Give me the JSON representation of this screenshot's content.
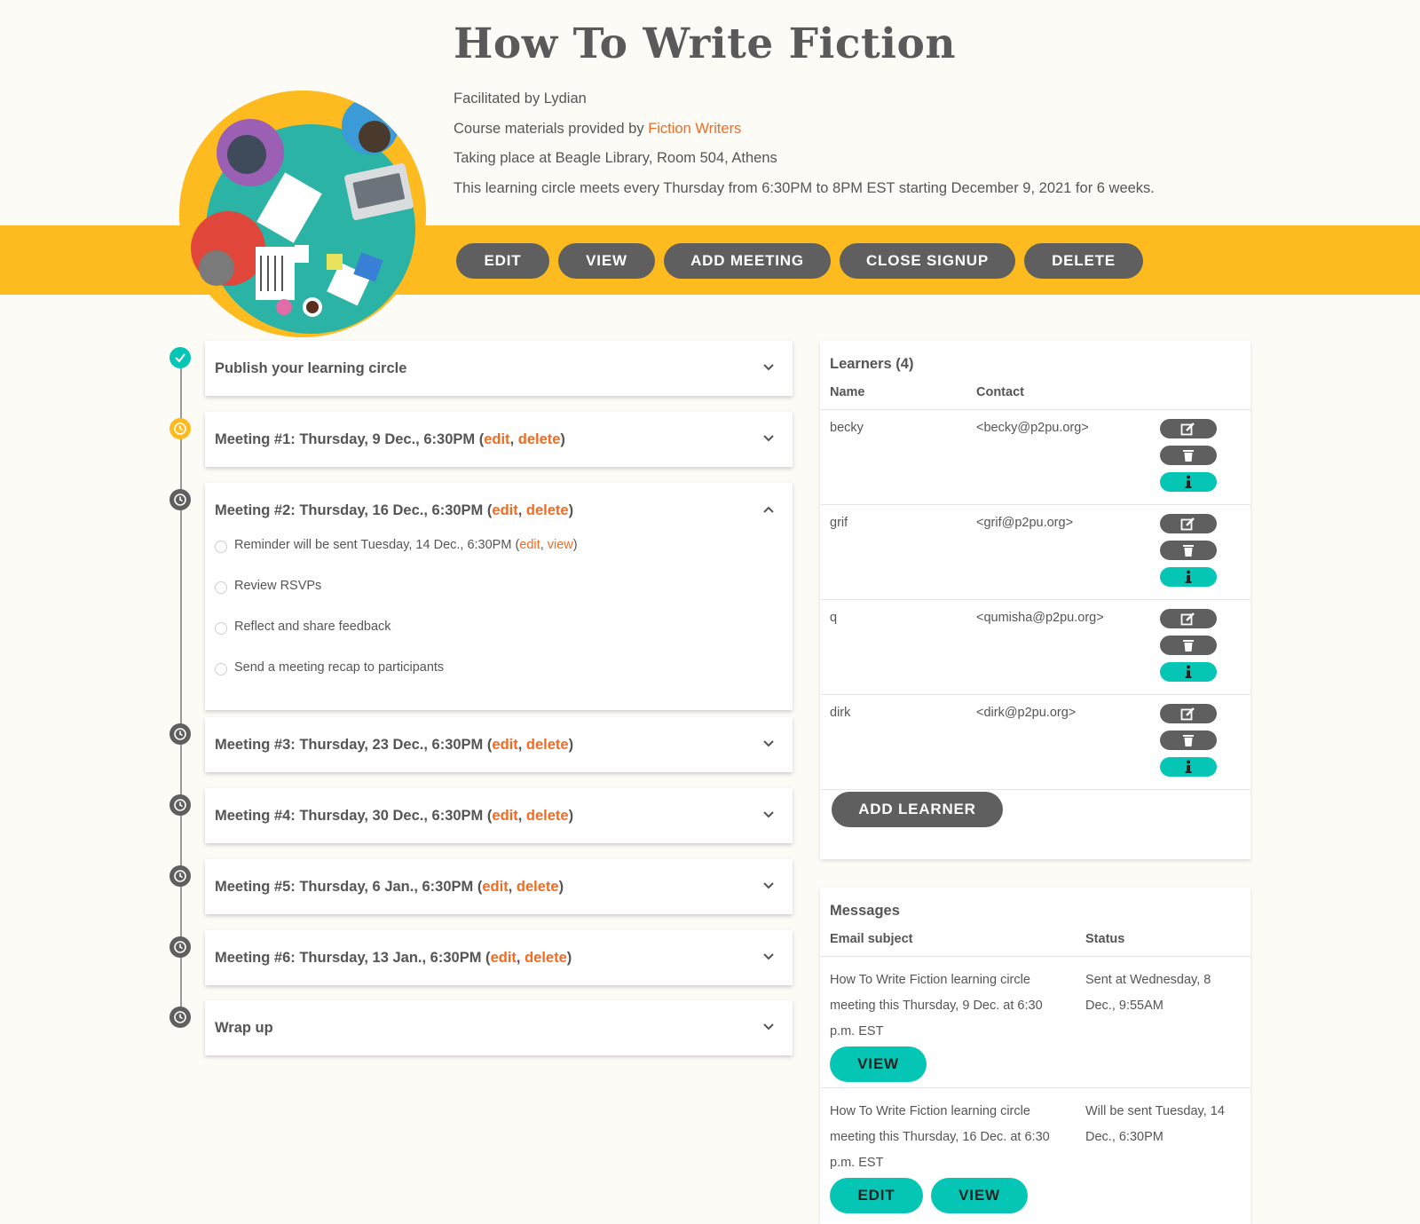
{
  "course": {
    "title": "How To Write Fiction",
    "facilitated_by": "Facilitated by Lydian",
    "materials_prefix": "Course materials provided by ",
    "materials_link": "Fiction Writers",
    "location": "Taking place at Beagle Library, Room 504, Athens",
    "schedule": "This learning circle meets every Thursday from 6:30PM to 8PM EST starting December 9, 2021 for 6 weeks."
  },
  "actions": {
    "edit": "EDIT",
    "view": "VIEW",
    "add_meeting": "ADD MEETING",
    "close_signup": "CLOSE SIGNUP",
    "delete": "DELETE"
  },
  "timeline": {
    "publish": "Publish your learning circle",
    "wrap_up": "Wrap up",
    "edit_link": "edit",
    "delete_link": "delete",
    "view_link": "view",
    "meetings": [
      {
        "label": "Meeting #1: Thursday, 9 Dec., 6:30PM",
        "status": "pending"
      },
      {
        "label": "Meeting #2: Thursday, 16 Dec., 6:30PM",
        "status": "future"
      },
      {
        "label": "Meeting #3: Thursday, 23 Dec., 6:30PM",
        "status": "future"
      },
      {
        "label": "Meeting #4: Thursday, 30 Dec., 6:30PM",
        "status": "future"
      },
      {
        "label": "Meeting #5: Thursday, 6 Jan., 6:30PM",
        "status": "future"
      },
      {
        "label": "Meeting #6: Thursday, 13 Jan., 6:30PM",
        "status": "future"
      }
    ],
    "meeting2_tasks": {
      "reminder": "Reminder will be sent Tuesday, 14 Dec., 6:30PM",
      "rsvps": "Review RSVPs",
      "reflect": "Reflect and share feedback",
      "recap": "Send a meeting recap to participants"
    }
  },
  "learners": {
    "title": "Learners (4)",
    "col_name": "Name",
    "col_contact": "Contact",
    "rows": [
      {
        "name": "becky",
        "contact": "<becky@p2pu.org>"
      },
      {
        "name": "grif",
        "contact": "<grif@p2pu.org>"
      },
      {
        "name": "q",
        "contact": "<qumisha@p2pu.org>"
      },
      {
        "name": "dirk",
        "contact": "<dirk@p2pu.org>"
      }
    ],
    "add_button": "ADD LEARNER"
  },
  "messages": {
    "title": "Messages",
    "col_subject": "Email subject",
    "col_status": "Status",
    "rows": [
      {
        "subject": "How To Write Fiction learning circle meeting this Thursday, 9 Dec. at 6:30 p.m. EST",
        "status": "Sent at Wednesday, 8 Dec., 9:55AM",
        "buttons": [
          "VIEW"
        ]
      },
      {
        "subject": "How To Write Fiction learning circle meeting this Thursday, 16 Dec. at 6:30 p.m. EST",
        "status": "Will be sent Tuesday, 14 Dec., 6:30PM",
        "buttons": [
          "EDIT",
          "VIEW"
        ]
      }
    ]
  },
  "colors": {
    "accent": "#fdbb1f",
    "link": "#f26b21",
    "teal": "#05c6b4",
    "dark_button": "#5f5f5f",
    "background": "#fcfbf6"
  }
}
